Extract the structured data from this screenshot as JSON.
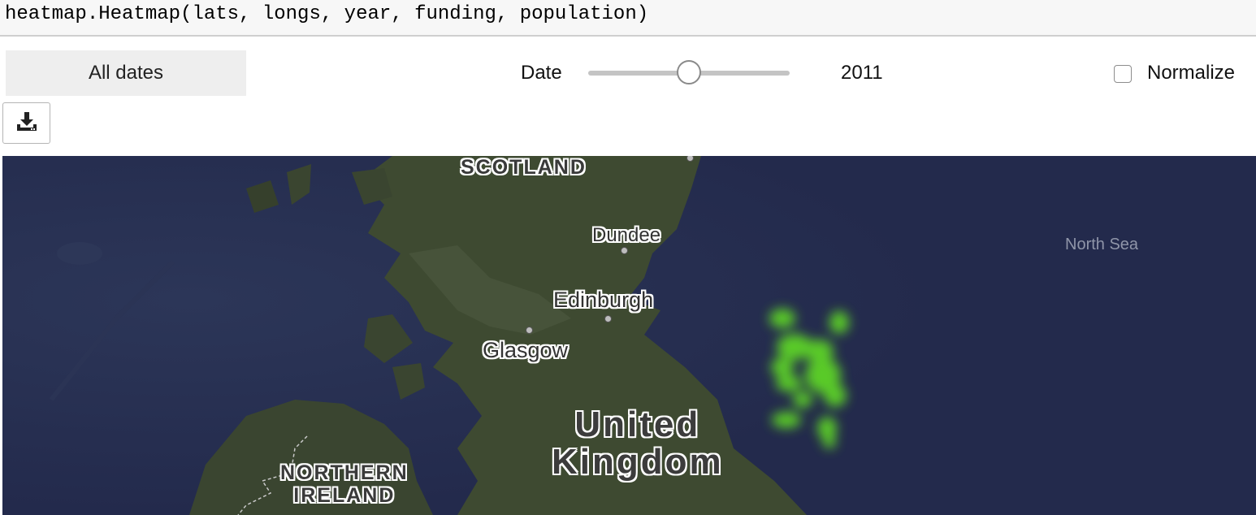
{
  "code": {
    "line": "heatmap.Heatmap(lats, longs, year, funding, population)"
  },
  "controls": {
    "all_dates_label": "All dates",
    "date_label": "Date",
    "date_value": "2011",
    "slider_fraction": 0.5,
    "normalize_label": "Normalize",
    "normalize_checked": false,
    "download_icon": "download-icon"
  },
  "map": {
    "labels": {
      "scotland": "SCOTLAND",
      "dundee": "Dundee",
      "edinburgh": "Edinburgh",
      "glasgow": "Glasgow",
      "country_line1": "United",
      "country_line2": "Kingdom",
      "northern_line1": "NORTHERN",
      "northern_line2": "IRELAND",
      "north_sea": "North Sea"
    },
    "colors": {
      "sea": "#232a4c",
      "land": "#3e4a31",
      "heat": "#63e620"
    }
  }
}
